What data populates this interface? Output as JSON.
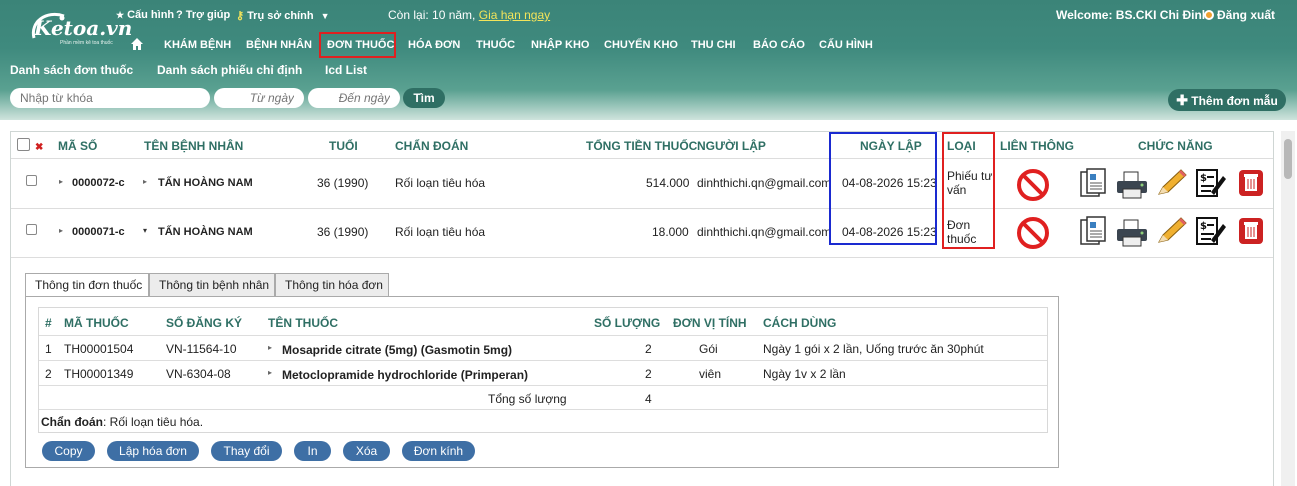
{
  "header": {
    "logo": {
      "name": "Ketoa.vn",
      "tagline": "Phần mềm kê toa thuốc"
    },
    "top_links": [
      {
        "icon": "star-icon",
        "label": "Cấu hình"
      },
      {
        "icon": "question-icon",
        "label": "Trợ giúp"
      },
      {
        "icon": "key-icon",
        "label": "Trụ sở chính"
      }
    ],
    "remaining": "Còn lại: 10 năm,",
    "renew": "Gia hạn ngay",
    "welcome": "Welcome: BS.CKI Chi Đinh",
    "logout": "Đăng xuất"
  },
  "nav": [
    "KHÁM BỆNH",
    "BỆNH NHÂN",
    "ĐƠN THUỐC",
    "HÓA ĐƠN",
    "THUỐC",
    "NHẬP KHO",
    "CHUYỂN KHO",
    "THU CHI",
    "BÁO CÁO",
    "CẤU HÌNH"
  ],
  "subnav": [
    "Danh sách đơn thuốc",
    "Danh sách phiếu chỉ định",
    "Icd List"
  ],
  "search": {
    "keyword_placeholder": "Nhập từ khóa",
    "from_placeholder": "Từ ngày",
    "to_placeholder": "Đến ngày",
    "find": "Tìm",
    "add": "Thêm đơn mẫu"
  },
  "table": {
    "headers": [
      "MÃ SỐ",
      "TÊN BỆNH NHÂN",
      "TUỔI",
      "CHẨN ĐOÁN",
      "TỔNG TIỀN THUỐC",
      "NGƯỜI LẬP",
      "NGÀY LẬP",
      "LOẠI",
      "LIÊN THÔNG",
      "CHỨC NĂNG"
    ],
    "rows": [
      {
        "id": "0000072-c",
        "name": "TẤN HOÀNG NAM",
        "age": "36 (1990)",
        "diagnosis": "Rối loạn tiêu hóa",
        "total": "514.000",
        "creator": "dinhthichi.qn@gmail.com",
        "date": "04-08-2026 15:23",
        "type_l1": "Phiếu tư",
        "type_l2": "vấn"
      },
      {
        "id": "0000071-c",
        "name": "TẤN HOÀNG NAM",
        "age": "36 (1990)",
        "diagnosis": "Rối loạn tiêu hóa",
        "total": "18.000",
        "creator": "dinhthichi.qn@gmail.com",
        "date": "04-08-2026 15:23",
        "type_l1": "Đơn",
        "type_l2": "thuốc"
      }
    ]
  },
  "detail": {
    "tabs": [
      "Thông tin đơn thuốc",
      "Thông tin bệnh nhân",
      "Thông tin hóa đơn"
    ],
    "headers": [
      "#",
      "MÃ THUỐC",
      "SỐ ĐĂNG KÝ",
      "TÊN THUỐC",
      "SỐ LƯỢNG",
      "ĐƠN VỊ TÍNH",
      "CÁCH DÙNG"
    ],
    "rows": [
      {
        "no": "1",
        "code": "TH00001504",
        "reg": "VN-11564-10",
        "name": "Mosapride citrate (5mg) (Gasmotin 5mg)",
        "qty": "2",
        "unit": "Gói",
        "usage": "Ngày 1 gói x 2 lần, Uống trước ăn 30phút"
      },
      {
        "no": "2",
        "code": "TH00001349",
        "reg": "VN-6304-08",
        "name": "Metoclopramide hydrochloride (Primperan)",
        "qty": "2",
        "unit": "viên",
        "usage": "Ngày 1v x 2 lần"
      }
    ],
    "total_label": "Tổng số lượng",
    "total_value": "4",
    "diag_label": "Chẩn đoán",
    "diag_value": ": Rối loạn tiêu hóa.",
    "buttons": [
      "Copy",
      "Lập hóa đơn",
      "Thay đổi",
      "In",
      "Xóa",
      "Đơn kính"
    ]
  },
  "colors": {
    "header": "#3f8a7e",
    "accent": "#2f6f64",
    "highlight_red": "#e02020",
    "highlight_blue": "#1a2ad0",
    "button_blue": "#3e6fa5"
  }
}
